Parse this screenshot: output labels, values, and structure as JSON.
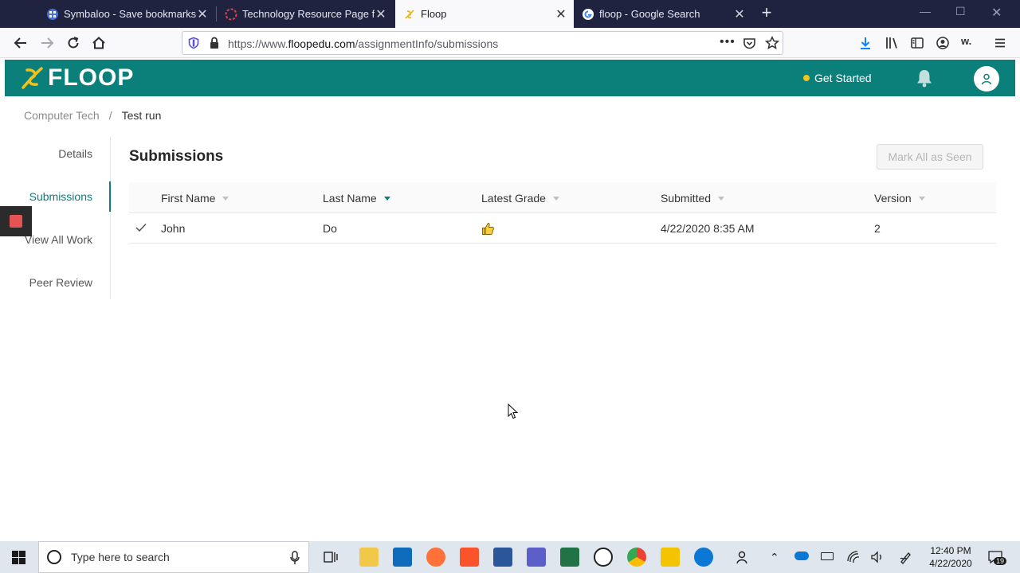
{
  "browser": {
    "tabs": [
      {
        "title": "Symbaloo - Save bookmarks and",
        "active": false
      },
      {
        "title": "Technology Resource Page for T",
        "active": false
      },
      {
        "title": "Floop",
        "active": true
      },
      {
        "title": "floop - Google Search",
        "active": false
      }
    ],
    "url_prefix": "https://www.",
    "url_domain": "floopedu.com",
    "url_path": "/assignmentInfo/submissions"
  },
  "app": {
    "logo_text": "FLOOP",
    "get_started": "Get Started",
    "accent_color": "#0b7f7a"
  },
  "breadcrumb": {
    "parent": "Computer Tech",
    "separator": "/",
    "current": "Test run"
  },
  "sidenav": {
    "items": [
      {
        "label": "Details",
        "active": false
      },
      {
        "label": "Submissions",
        "active": true
      },
      {
        "label": "View All Work",
        "active": false
      },
      {
        "label": "Peer Review",
        "active": false
      }
    ]
  },
  "main": {
    "title": "Submissions",
    "mark_all_seen": "Mark All as Seen",
    "columns": [
      "First Name",
      "Last Name",
      "Latest Grade",
      "Submitted",
      "Version"
    ],
    "rows": [
      {
        "seen": true,
        "first": "John",
        "last": "Do",
        "grade_icon": "thumbs-up-icon",
        "submitted": "4/22/2020 8:35 AM",
        "version": "2"
      }
    ]
  },
  "taskbar": {
    "search_placeholder": "Type here to search",
    "time": "12:40 PM",
    "date": "4/22/2020",
    "notification_count": "19"
  }
}
